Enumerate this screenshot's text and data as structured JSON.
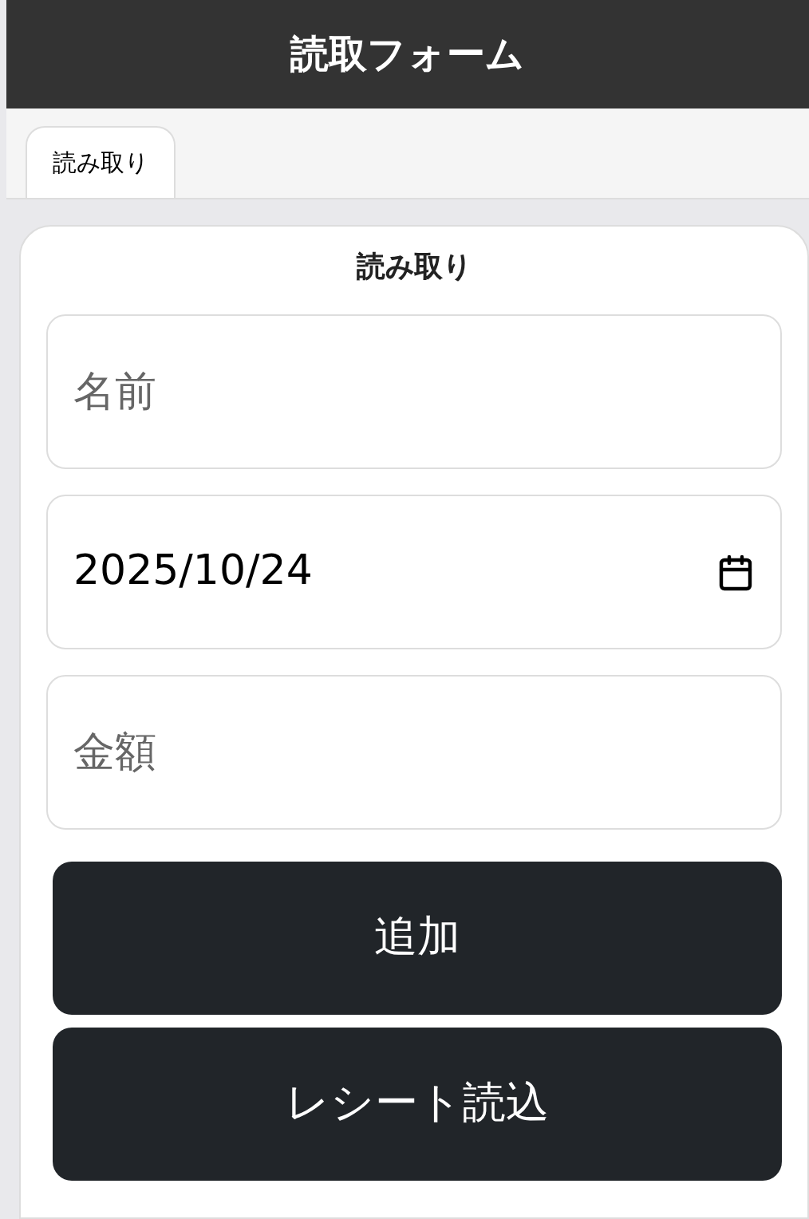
{
  "header": {
    "title": "読取フォーム"
  },
  "tabs": [
    {
      "label": "読み取り",
      "selected": true
    }
  ],
  "form": {
    "title": "読み取り",
    "fields": [
      {
        "kind": "text",
        "placeholder": "名前"
      },
      {
        "kind": "date",
        "value": "2025/10/24"
      },
      {
        "kind": "text",
        "placeholder": "金額"
      }
    ],
    "buttons": [
      "追加",
      "レシート読込"
    ]
  }
}
